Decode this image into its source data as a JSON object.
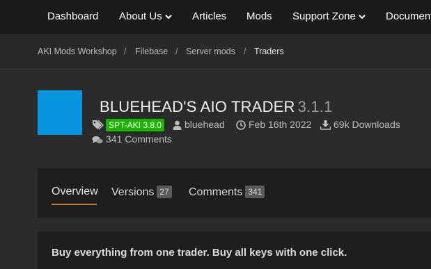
{
  "nav": {
    "dashboard": "Dashboard",
    "about": "About Us",
    "articles": "Articles",
    "mods": "Mods",
    "support": "Support Zone",
    "documentation": "Documentation"
  },
  "breadcrumb": {
    "home": "AKI Mods Workshop",
    "sep": "/",
    "filebase": "Filebase",
    "server_mods": "Server mods",
    "current": "Traders"
  },
  "file": {
    "title": "BLUEHEAD'S AIO TRADER",
    "version": "3.1.1",
    "badge": "SPT-AKI 3.8.0",
    "badge_color": "#1bb400",
    "icon_color": "#0795e0",
    "author": "bluehead",
    "date": "Feb 16th 2022",
    "downloads": "69k Downloads",
    "comments": "341 Comments"
  },
  "tabs": {
    "overview": "Overview",
    "versions": "Versions",
    "versions_count": "27",
    "comments": "Comments",
    "comments_count": "341"
  },
  "description": "Buy everything from one trader. Buy all keys with one click."
}
